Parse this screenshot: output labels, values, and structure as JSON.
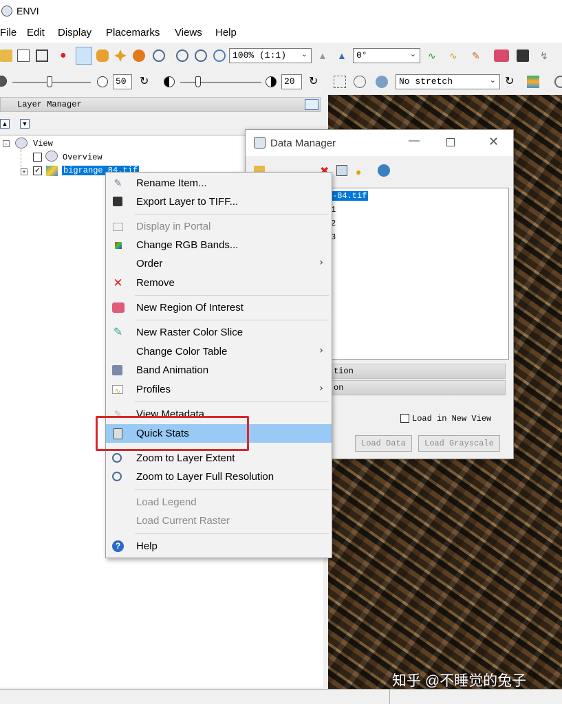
{
  "app": {
    "title": "ENVI"
  },
  "menubar": [
    "File",
    "Edit",
    "Display",
    "Placemarks",
    "Views",
    "Help"
  ],
  "toolbar": {
    "zoom": "100% (1:1)",
    "rotation": "0°"
  },
  "toolbar2": {
    "brightness": "50",
    "contrast": "20",
    "stretch": "No stretch"
  },
  "layer_manager": {
    "title": "Layer Manager",
    "tree": {
      "view": "View",
      "overview": "Overview",
      "layer": "bigrange 84.tif"
    }
  },
  "data_manager": {
    "title": "Data Manager",
    "files": [
      "-84.tif",
      "1",
      "2",
      "3"
    ],
    "sections": [
      "tion",
      "on"
    ],
    "load_new_view": "Load in New View",
    "load_data": "Load Data",
    "load_grayscale": "Load Grayscale"
  },
  "context_menu": [
    {
      "label": "Rename Item...",
      "icon": "rename-icon"
    },
    {
      "label": "Export Layer to TIFF...",
      "icon": "save-icon"
    },
    {
      "label": "Display in Portal",
      "icon": "portal-icon",
      "disabled": true
    },
    {
      "label": "Change RGB Bands...",
      "icon": "rgb-icon"
    },
    {
      "label": "Order",
      "submenu": true
    },
    {
      "label": "Remove",
      "icon": "remove-icon"
    },
    {
      "label": "New Region Of Interest",
      "icon": "roi-icon"
    },
    {
      "label": "New Raster Color Slice",
      "icon": "color-slice-icon"
    },
    {
      "label": "Change Color Table",
      "submenu": true
    },
    {
      "label": "Band Animation",
      "icon": "animation-icon"
    },
    {
      "label": "Profiles",
      "icon": "profile-icon",
      "submenu": true
    },
    {
      "label": "View Metadata",
      "icon": "metadata-icon"
    },
    {
      "label": "Quick Stats",
      "icon": "calculator-icon",
      "highlighted": true
    },
    {
      "label": "Zoom to Layer Extent",
      "icon": "zoom-extent-icon"
    },
    {
      "label": "Zoom to Layer Full Resolution",
      "icon": "zoom-full-icon"
    },
    {
      "label": "Load Legend",
      "disabled": true
    },
    {
      "label": "Load Current Raster",
      "disabled": true
    },
    {
      "label": "Help",
      "icon": "help-icon"
    }
  ],
  "watermark": "知乎 @不睡觉的兔子"
}
